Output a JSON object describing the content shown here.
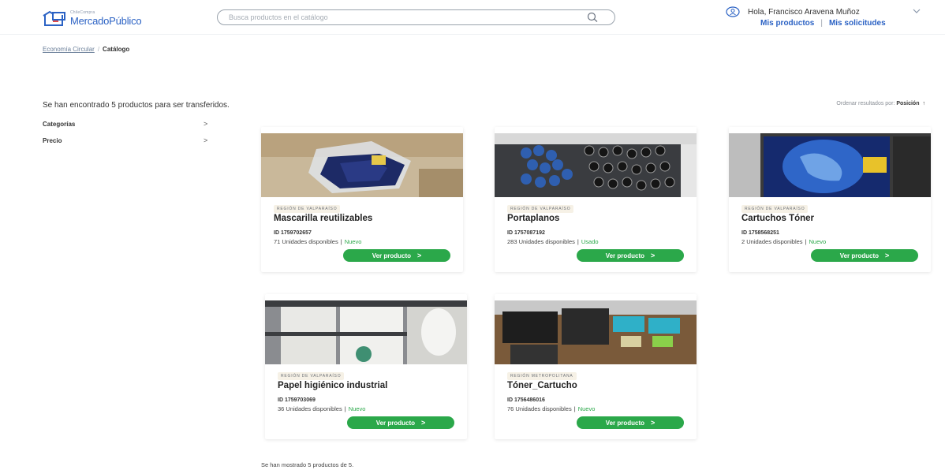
{
  "header": {
    "logo_small": "ChileCompra",
    "logo_main": "MercadoPúblico",
    "search_placeholder": "Busca productos en el catálogo",
    "user_greeting": "Hola, Francisco Aravena Muñoz",
    "link_products": "Mis productos",
    "link_requests": "Mis solicitudes",
    "link_separator": "|"
  },
  "breadcrumb": {
    "parent": "Economía Circular",
    "separator": "/",
    "current": "Catálogo"
  },
  "results": {
    "found_text": "Se han encontrado 5 productos para ser transferidos.",
    "sort_label": "Ordenar resultados por:",
    "sort_value": "Posición",
    "sort_arrow": "↑",
    "shown_text": "Se han mostrado 5 productos de 5."
  },
  "filters": [
    {
      "label": "Categorías",
      "chevron": ">"
    },
    {
      "label": "Precio",
      "chevron": ">"
    }
  ],
  "products": [
    {
      "region": "REGIÓN DE VALPARAÍSO",
      "name": "Mascarilla reutilizables",
      "id": "ID 1759702657",
      "stock": "71 Unidades disponibles",
      "sep": "|",
      "condition": "Nuevo",
      "button": "Ver producto",
      "arrow": ">"
    },
    {
      "region": "REGIÓN DE VALPARAÍSO",
      "name": "Portaplanos",
      "id": "ID 1757087192",
      "stock": "283 Unidades disponibles",
      "sep": "|",
      "condition": "Usado",
      "button": "Ver producto",
      "arrow": ">"
    },
    {
      "region": "REGIÓN DE VALPARAÍSO",
      "name": "Cartuchos Tóner",
      "id": "ID 1758568251",
      "stock": "2 Unidades disponibles",
      "sep": "|",
      "condition": "Nuevo",
      "button": "Ver producto",
      "arrow": ">"
    },
    {
      "region": "REGIÓN DE VALPARAÍSO",
      "name": "Papel higiénico industrial",
      "id": "ID 1759703069",
      "stock": "36 Unidades disponibles",
      "sep": "|",
      "condition": "Nuevo",
      "button": "Ver producto",
      "arrow": ">"
    },
    {
      "region": "REGIÓN METROPOLITANA",
      "name": "Tóner_Cartucho",
      "id": "ID 1756486016",
      "stock": "76 Unidades disponibles",
      "sep": "|",
      "condition": "Nuevo",
      "button": "Ver producto",
      "arrow": ">"
    }
  ],
  "colors": {
    "brand_blue": "#2b62c4",
    "button_green": "#2ba84a",
    "condition_green": "#2ba84a"
  }
}
